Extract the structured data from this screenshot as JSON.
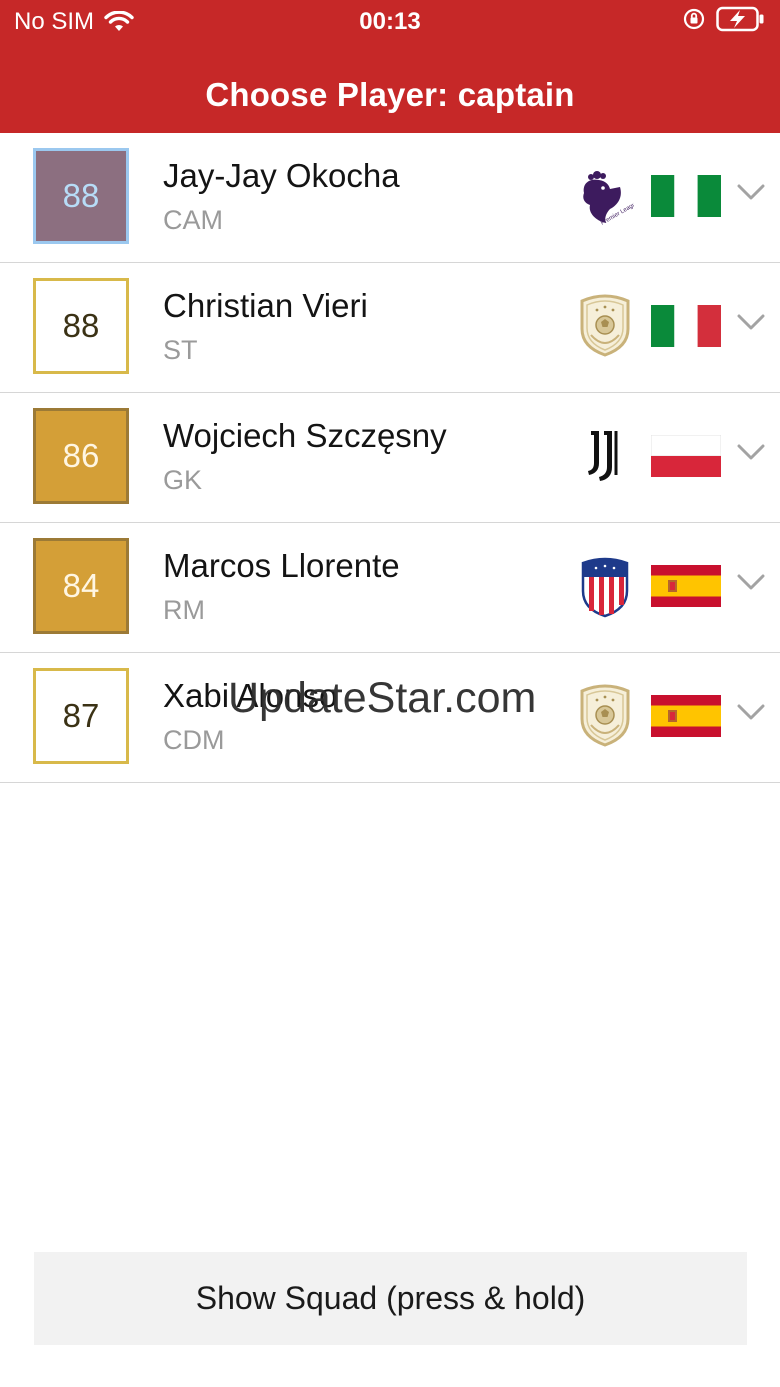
{
  "status_bar": {
    "carrier": "No SIM",
    "time": "00:13"
  },
  "header": {
    "title": "Choose Player: captain"
  },
  "players": [
    {
      "rating": "88",
      "name": "Jay-Jay Okocha",
      "position": "CAM",
      "club_icon": "premier-league-icon",
      "flag": "nigeria-flag"
    },
    {
      "rating": "88",
      "name": "Christian Vieri",
      "position": "ST",
      "club_icon": "icons-badge-icon",
      "flag": "italy-flag"
    },
    {
      "rating": "86",
      "name": "Wojciech Szczęsny",
      "position": "GK",
      "club_icon": "juventus-icon",
      "flag": "poland-flag"
    },
    {
      "rating": "84",
      "name": "Marcos Llorente",
      "position": "RM",
      "club_icon": "atletico-madrid-icon",
      "flag": "spain-flag"
    },
    {
      "rating": "87",
      "name": "Xabi Alonso",
      "position": "CDM",
      "club_icon": "icons-badge-icon",
      "flag": "spain-flag"
    }
  ],
  "watermark": "UpdateStar.com",
  "show_squad_button": "Show Squad (press & hold)",
  "colors": {
    "header_bg": "#c62828",
    "card_purple": "#8c6f80",
    "card_gold": "#d49f37",
    "card_icon_border": "#d8b94a"
  }
}
